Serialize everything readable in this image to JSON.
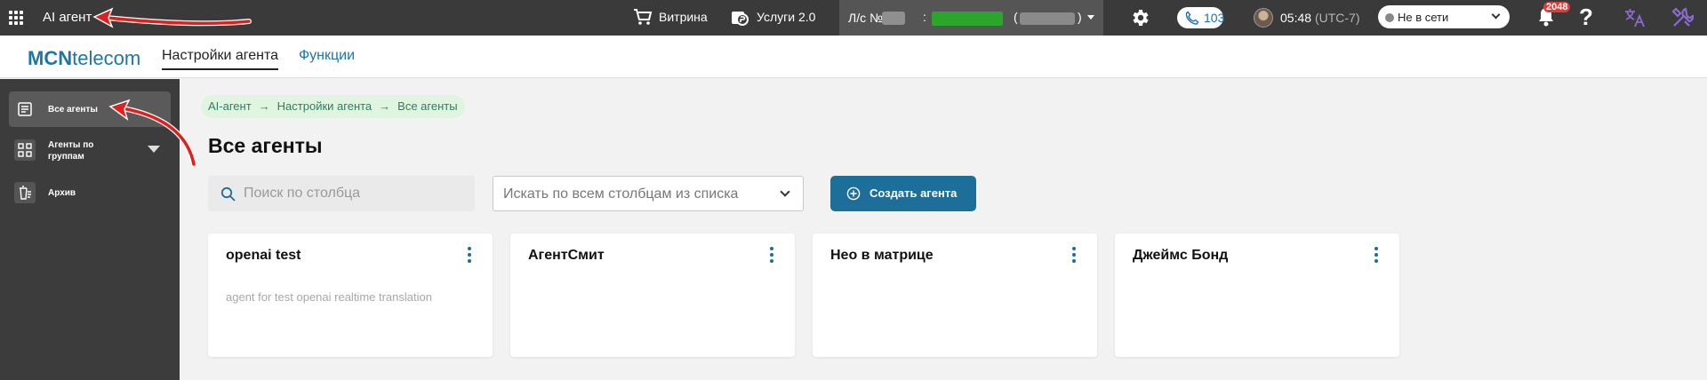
{
  "topbar": {
    "app_title": "AI агент",
    "vitrina_label": "Витрина",
    "services_label": "Услуги 2.0",
    "account_label": "Л/с №",
    "account_colon": ":",
    "account_paren_open": "(",
    "account_paren_close": ")",
    "calls_count": "103",
    "time": "05:48",
    "timezone": "(UTC-7)",
    "status": "Не в сети",
    "notifications_count": "2048",
    "help_label": "?"
  },
  "subheader": {
    "logo_bold": "MCN",
    "logo_rest": "telecom",
    "tabs": [
      {
        "label": "Настройки агента"
      },
      {
        "label": "Функции"
      }
    ]
  },
  "sidebar": {
    "items": [
      {
        "label": "Все агенты",
        "icon": "list-icon"
      },
      {
        "label": "Агенты по группам",
        "icon": "grid-icon"
      },
      {
        "label": "Архив",
        "icon": "archive-icon"
      }
    ]
  },
  "breadcrumb": [
    "AI-агент",
    "Настройки агента",
    "Все агенты"
  ],
  "breadcrumb_separator": "→",
  "page_title": "Все агенты",
  "search": {
    "placeholder": "Поиск по столбца"
  },
  "column_select": {
    "placeholder": "Искать по всем столбцам из списка"
  },
  "create_button": "Создать агента",
  "cards": [
    {
      "title": "openai test",
      "description": "agent for test openai realtime translation"
    },
    {
      "title": "АгентСмит",
      "description": ""
    },
    {
      "title": "Нео в матрице",
      "description": ""
    },
    {
      "title": "Джеймс Бонд",
      "description": ""
    }
  ],
  "colors": {
    "topbar_bg": "#3a3a3a",
    "sidebar_bg": "#3c3c3c",
    "accent_blue": "#1d6e99",
    "breadcrumb_bg": "#dff5df",
    "annotation_red": "#e0201c"
  }
}
